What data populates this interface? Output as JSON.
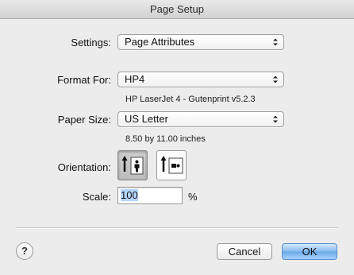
{
  "window": {
    "title": "Page Setup"
  },
  "settings": {
    "label": "Settings:",
    "value": "Page Attributes"
  },
  "format_for": {
    "label": "Format For:",
    "value": "HP4",
    "description": "HP LaserJet 4 - Gutenprint v5.2.3"
  },
  "paper_size": {
    "label": "Paper Size:",
    "value": "US Letter",
    "description": "8.50 by 11.00 inches"
  },
  "orientation": {
    "label": "Orientation:",
    "options": [
      "portrait",
      "landscape"
    ],
    "selected": "portrait"
  },
  "scale": {
    "label": "Scale:",
    "value": "100",
    "unit": "%"
  },
  "buttons": {
    "cancel": "Cancel",
    "ok": "OK",
    "help": "?"
  }
}
